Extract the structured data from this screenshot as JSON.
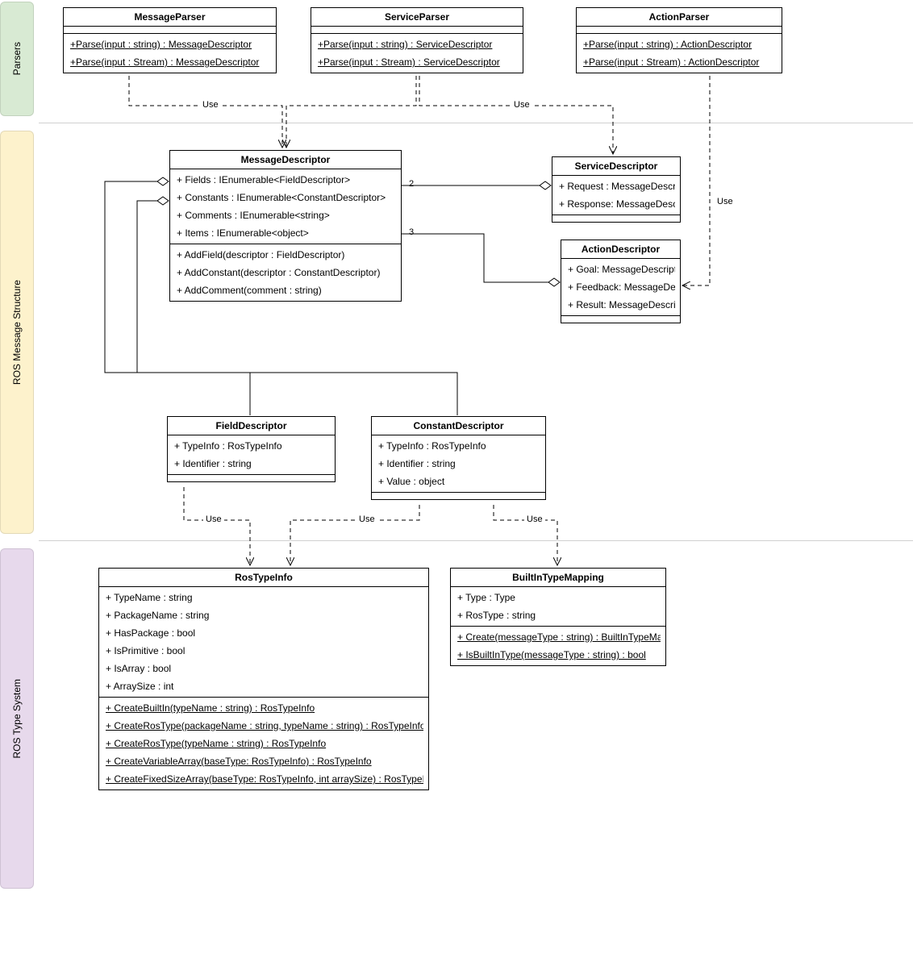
{
  "swimlanes": {
    "parsers": {
      "label": "Parsers"
    },
    "structure": {
      "label": "ROS Message Structure"
    },
    "typesystem": {
      "label": "ROS Type System"
    }
  },
  "classes": {
    "MessageParser": {
      "title": "MessageParser",
      "methods": [
        "+Parse(input : string) : MessageDescriptor",
        "+Parse(input : Stream) : MessageDescriptor"
      ]
    },
    "ServiceParser": {
      "title": "ServiceParser",
      "methods": [
        "+Parse(input : string) : ServiceDescriptor",
        "+Parse(input : Stream) : ServiceDescriptor"
      ]
    },
    "ActionParser": {
      "title": "ActionParser",
      "methods": [
        "+Parse(input : string) : ActionDescriptor",
        "+Parse(input : Stream) : ActionDescriptor"
      ]
    },
    "MessageDescriptor": {
      "title": "MessageDescriptor",
      "props": [
        "+ Fields : IEnumerable<FieldDescriptor>",
        "+ Constants : IEnumerable<ConstantDescriptor>",
        "+ Comments : IEnumerable<string>",
        "+ Items : IEnumerable<object>"
      ],
      "methods": [
        "+ AddField(descriptor : FieldDescriptor)",
        "+ AddConstant(descriptor : ConstantDescriptor)",
        "+ AddComment(comment : string)"
      ]
    },
    "ServiceDescriptor": {
      "title": "ServiceDescriptor",
      "props": [
        "+ Request : MessageDescri...",
        "+ Response: MessageDescr..."
      ]
    },
    "ActionDescriptor": {
      "title": "ActionDescriptor",
      "props": [
        "+ Goal: MessageDescriptor",
        "+ Feedback: MessageDescri...",
        "+ Result: MessageDescripto..."
      ]
    },
    "FieldDescriptor": {
      "title": "FieldDescriptor",
      "props": [
        "+ TypeInfo : RosTypeInfo",
        "+ Identifier : string"
      ]
    },
    "ConstantDescriptor": {
      "title": "ConstantDescriptor",
      "props": [
        "+ TypeInfo : RosTypeInfo",
        "+ Identifier : string",
        "+ Value : object"
      ]
    },
    "RosTypeInfo": {
      "title": "RosTypeInfo",
      "props": [
        "+ TypeName : string",
        "+ PackageName : string",
        "+ HasPackage : bool",
        "+ IsPrimitive : bool",
        "+ IsArray : bool",
        "+ ArraySize : int"
      ],
      "statics": [
        "+ CreateBuiltIn(typeName : string) : RosTypeInfo",
        "+ CreateRosType(packageName : string, typeName : string) : RosTypeInfo",
        "+ CreateRosType(typeName : string) : RosTypeInfo",
        "+ CreateVariableArray(baseType: RosTypeInfo) : RosTypeInfo",
        "+ CreateFixedSizeArray(baseType: RosTypeInfo, int arraySize) : RosTypeInfo"
      ]
    },
    "BuiltInTypeMapping": {
      "title": "BuiltInTypeMapping",
      "props": [
        "+ Type : Type",
        "+ RosType : string"
      ],
      "statics": [
        "+ Create(messageType : string) : BuiltInTypeMappi...",
        "+ IsBuiltInType(messageType : string) : bool"
      ]
    }
  },
  "edgeLabels": {
    "use1": "Use",
    "use2": "Use",
    "useAP": "Use",
    "useFD": "Use",
    "useCD1": "Use",
    "useCD2": "Use"
  },
  "multiplicities": {
    "svc": "2",
    "act": "3"
  },
  "chart_data": {
    "type": "uml_class_diagram",
    "packages": [
      {
        "name": "Parsers",
        "classes": [
          "MessageParser",
          "ServiceParser",
          "ActionParser"
        ]
      },
      {
        "name": "ROS Message Structure",
        "classes": [
          "MessageDescriptor",
          "ServiceDescriptor",
          "ActionDescriptor",
          "FieldDescriptor",
          "ConstantDescriptor"
        ]
      },
      {
        "name": "ROS Type System",
        "classes": [
          "RosTypeInfo",
          "BuiltInTypeMapping"
        ]
      }
    ],
    "classes": {
      "MessageParser": {
        "operations": [
          {
            "name": "Parse",
            "params": [
              {
                "name": "input",
                "type": "string"
              }
            ],
            "returns": "MessageDescriptor",
            "visibility": "+",
            "static": true
          },
          {
            "name": "Parse",
            "params": [
              {
                "name": "input",
                "type": "Stream"
              }
            ],
            "returns": "MessageDescriptor",
            "visibility": "+",
            "static": true
          }
        ]
      },
      "ServiceParser": {
        "operations": [
          {
            "name": "Parse",
            "params": [
              {
                "name": "input",
                "type": "string"
              }
            ],
            "returns": "ServiceDescriptor",
            "visibility": "+",
            "static": true
          },
          {
            "name": "Parse",
            "params": [
              {
                "name": "input",
                "type": "Stream"
              }
            ],
            "returns": "ServiceDescriptor",
            "visibility": "+",
            "static": true
          }
        ]
      },
      "ActionParser": {
        "operations": [
          {
            "name": "Parse",
            "params": [
              {
                "name": "input",
                "type": "string"
              }
            ],
            "returns": "ActionDescriptor",
            "visibility": "+",
            "static": true
          },
          {
            "name": "Parse",
            "params": [
              {
                "name": "input",
                "type": "Stream"
              }
            ],
            "returns": "ActionDescriptor",
            "visibility": "+",
            "static": true
          }
        ]
      },
      "MessageDescriptor": {
        "attributes": [
          {
            "name": "Fields",
            "type": "IEnumerable<FieldDescriptor>",
            "visibility": "+"
          },
          {
            "name": "Constants",
            "type": "IEnumerable<ConstantDescriptor>",
            "visibility": "+"
          },
          {
            "name": "Comments",
            "type": "IEnumerable<string>",
            "visibility": "+"
          },
          {
            "name": "Items",
            "type": "IEnumerable<object>",
            "visibility": "+"
          }
        ],
        "operations": [
          {
            "name": "AddField",
            "params": [
              {
                "name": "descriptor",
                "type": "FieldDescriptor"
              }
            ],
            "visibility": "+"
          },
          {
            "name": "AddConstant",
            "params": [
              {
                "name": "descriptor",
                "type": "ConstantDescriptor"
              }
            ],
            "visibility": "+"
          },
          {
            "name": "AddComment",
            "params": [
              {
                "name": "comment",
                "type": "string"
              }
            ],
            "visibility": "+"
          }
        ]
      },
      "ServiceDescriptor": {
        "attributes": [
          {
            "name": "Request",
            "type": "MessageDescriptor",
            "visibility": "+"
          },
          {
            "name": "Response",
            "type": "MessageDescriptor",
            "visibility": "+"
          }
        ]
      },
      "ActionDescriptor": {
        "attributes": [
          {
            "name": "Goal",
            "type": "MessageDescriptor",
            "visibility": "+"
          },
          {
            "name": "Feedback",
            "type": "MessageDescriptor",
            "visibility": "+"
          },
          {
            "name": "Result",
            "type": "MessageDescriptor",
            "visibility": "+"
          }
        ]
      },
      "FieldDescriptor": {
        "attributes": [
          {
            "name": "TypeInfo",
            "type": "RosTypeInfo",
            "visibility": "+"
          },
          {
            "name": "Identifier",
            "type": "string",
            "visibility": "+"
          }
        ]
      },
      "ConstantDescriptor": {
        "attributes": [
          {
            "name": "TypeInfo",
            "type": "RosTypeInfo",
            "visibility": "+"
          },
          {
            "name": "Identifier",
            "type": "string",
            "visibility": "+"
          },
          {
            "name": "Value",
            "type": "object",
            "visibility": "+"
          }
        ]
      },
      "RosTypeInfo": {
        "attributes": [
          {
            "name": "TypeName",
            "type": "string",
            "visibility": "+"
          },
          {
            "name": "PackageName",
            "type": "string",
            "visibility": "+"
          },
          {
            "name": "HasPackage",
            "type": "bool",
            "visibility": "+"
          },
          {
            "name": "IsPrimitive",
            "type": "bool",
            "visibility": "+"
          },
          {
            "name": "IsArray",
            "type": "bool",
            "visibility": "+"
          },
          {
            "name": "ArraySize",
            "type": "int",
            "visibility": "+"
          }
        ],
        "operations": [
          {
            "name": "CreateBuiltIn",
            "params": [
              {
                "name": "typeName",
                "type": "string"
              }
            ],
            "returns": "RosTypeInfo",
            "visibility": "+",
            "static": true
          },
          {
            "name": "CreateRosType",
            "params": [
              {
                "name": "packageName",
                "type": "string"
              },
              {
                "name": "typeName",
                "type": "string"
              }
            ],
            "returns": "RosTypeInfo",
            "visibility": "+",
            "static": true
          },
          {
            "name": "CreateRosType",
            "params": [
              {
                "name": "typeName",
                "type": "string"
              }
            ],
            "returns": "RosTypeInfo",
            "visibility": "+",
            "static": true
          },
          {
            "name": "CreateVariableArray",
            "params": [
              {
                "name": "baseType",
                "type": "RosTypeInfo"
              }
            ],
            "returns": "RosTypeInfo",
            "visibility": "+",
            "static": true
          },
          {
            "name": "CreateFixedSizeArray",
            "params": [
              {
                "name": "baseType",
                "type": "RosTypeInfo"
              },
              {
                "name": "arraySize",
                "type": "int"
              }
            ],
            "returns": "RosTypeInfo",
            "visibility": "+",
            "static": true
          }
        ]
      },
      "BuiltInTypeMapping": {
        "attributes": [
          {
            "name": "Type",
            "type": "Type",
            "visibility": "+"
          },
          {
            "name": "RosType",
            "type": "string",
            "visibility": "+"
          }
        ],
        "operations": [
          {
            "name": "Create",
            "params": [
              {
                "name": "messageType",
                "type": "string"
              }
            ],
            "returns": "BuiltInTypeMapping",
            "visibility": "+",
            "static": true
          },
          {
            "name": "IsBuiltInType",
            "params": [
              {
                "name": "messageType",
                "type": "string"
              }
            ],
            "returns": "bool",
            "visibility": "+",
            "static": true
          }
        ]
      }
    },
    "relationships": [
      {
        "from": "MessageParser",
        "to": "MessageDescriptor",
        "type": "dependency",
        "label": "Use"
      },
      {
        "from": "ServiceParser",
        "to": "ServiceDescriptor",
        "type": "dependency",
        "label": "Use"
      },
      {
        "from": "ServiceParser",
        "to": "MessageDescriptor",
        "type": "dependency"
      },
      {
        "from": "ActionParser",
        "to": "ActionDescriptor",
        "type": "dependency",
        "label": "Use"
      },
      {
        "from": "ServiceDescriptor",
        "to": "MessageDescriptor",
        "type": "aggregation",
        "multiplicity": "2"
      },
      {
        "from": "ActionDescriptor",
        "to": "MessageDescriptor",
        "type": "aggregation",
        "multiplicity": "3"
      },
      {
        "from": "MessageDescriptor",
        "to": "FieldDescriptor",
        "type": "aggregation"
      },
      {
        "from": "MessageDescriptor",
        "to": "ConstantDescriptor",
        "type": "aggregation"
      },
      {
        "from": "FieldDescriptor",
        "to": "RosTypeInfo",
        "type": "dependency",
        "label": "Use"
      },
      {
        "from": "ConstantDescriptor",
        "to": "RosTypeInfo",
        "type": "dependency",
        "label": "Use"
      },
      {
        "from": "ConstantDescriptor",
        "to": "BuiltInTypeMapping",
        "type": "dependency",
        "label": "Use"
      }
    ]
  }
}
